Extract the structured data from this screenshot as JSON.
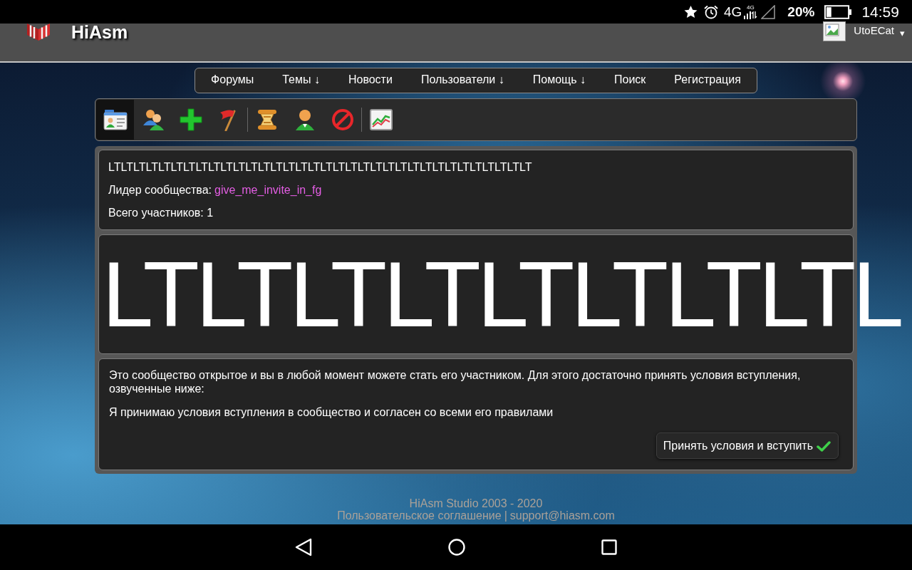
{
  "status_bar": {
    "network": "4G",
    "network_detail": "4G",
    "battery": "20%",
    "time": "14:59"
  },
  "header": {
    "site_name": "HiAsm",
    "user_name": "UtoECat",
    "menu_caret": "▾"
  },
  "nav": [
    "Форумы",
    "Темы ↓",
    "Новости",
    "Пользователи ↓",
    "Помощь ↓",
    "Поиск",
    "Регистрация"
  ],
  "toolbar": {
    "groups": [
      {
        "items": [
          {
            "selected": true
          },
          {
            "selected": false
          },
          {
            "selected": false
          },
          {
            "selected": false
          }
        ]
      },
      {
        "items": [
          {
            "selected": false
          },
          {
            "selected": false
          },
          {
            "selected": false
          }
        ]
      },
      {
        "items": [
          {
            "selected": false
          }
        ]
      }
    ]
  },
  "community": {
    "title": "LTLTLTLTLTLTLTLTLTLTLTLTLTLTLTLTLTLTLTLTLTLTLTLTLTLTLTLTLTLTLTLTLTLT",
    "leader_label": "Лидер сообщества:",
    "leader_name": "give_me_invite_in_fg",
    "members": "Всего участников: 1"
  },
  "banner": {
    "text": "LTLTLTLTLTLTLTLTL"
  },
  "join": {
    "description": "Это сообщество открытое и вы в любой момент можете стать его участником. Для этого достаточно принять условия вступления, озвученные ниже:",
    "terms": "Я принимаю условия вступления в сообщество и согласен со всеми его правилами",
    "button": "Принять условия и вступить"
  },
  "footer": {
    "copyright": "HiAsm Studio 2003 - 2020",
    "links": [
      "Пользовательское соглашение",
      "support@hiasm.com"
    ],
    "separator": "|"
  }
}
